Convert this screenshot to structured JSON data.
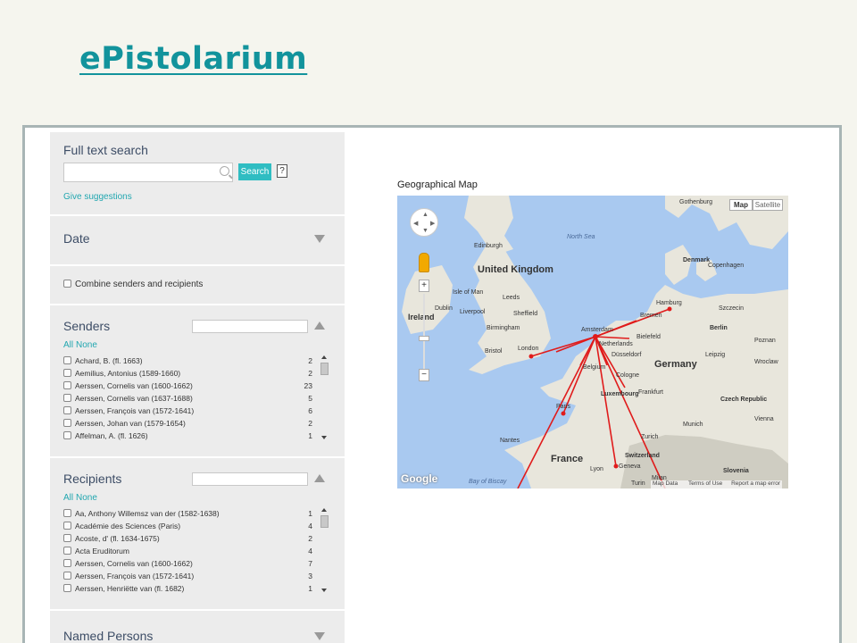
{
  "app_title": "ePistolarium",
  "full_text_search": {
    "heading": "Full text search",
    "search_label": "Search",
    "help_label": "?",
    "suggestions_link": "Give suggestions"
  },
  "date": {
    "heading": "Date"
  },
  "combine": {
    "label": "Combine senders and recipients"
  },
  "senders": {
    "heading": "Senders",
    "all_label": "All",
    "none_label": "None",
    "items": [
      {
        "name": "Achard, B. (fl. 1663)",
        "count": "2"
      },
      {
        "name": "Aemilius, Antonius (1589-1660)",
        "count": "2"
      },
      {
        "name": "Aerssen, Cornelis van (1600-1662)",
        "count": "23"
      },
      {
        "name": "Aerssen, Cornelis van (1637-1688)",
        "count": "5"
      },
      {
        "name": "Aerssen, François van (1572-1641)",
        "count": "6"
      },
      {
        "name": "Aerssen, Johan van (1579-1654)",
        "count": "2"
      },
      {
        "name": "Affelman, A. (fl. 1626)",
        "count": "1"
      }
    ]
  },
  "recipients": {
    "heading": "Recipients",
    "all_label": "All",
    "none_label": "None",
    "items": [
      {
        "name": "Aa, Anthony Willemsz van der (1582-1638)",
        "count": "1"
      },
      {
        "name": "Académie des Sciences (Paris)",
        "count": "4"
      },
      {
        "name": "Acoste, d' (fl. 1634-1675)",
        "count": "2"
      },
      {
        "name": "Acta Eruditorum",
        "count": "4"
      },
      {
        "name": "Aerssen, Cornelis van (1600-1662)",
        "count": "7"
      },
      {
        "name": "Aerssen, François van (1572-1641)",
        "count": "3"
      },
      {
        "name": "Aerssen, Henriëtte van (fl. 1682)",
        "count": "1"
      }
    ]
  },
  "named_persons": {
    "heading": "Named Persons"
  },
  "map": {
    "title": "Geographical Map",
    "type_map": "Map",
    "type_satellite": "Satellite",
    "footer_data": "Map Data",
    "footer_terms": "Terms of Use",
    "footer_report": "Report a map error",
    "google": "Google",
    "labels": {
      "gothenburg": "Gothenburg",
      "north_sea": "North Sea",
      "edinburgh": "Edinburgh",
      "denmark": "Denmark",
      "copenhagen": "Copenhagen",
      "uk": "United Kingdom",
      "isle_of_man": "Isle of Man",
      "leeds": "Leeds",
      "dublin": "Dublin",
      "liverpool": "Liverpool",
      "sheffield": "Sheffield",
      "ireland": "Ireland",
      "hamburg": "Hamburg",
      "bremen": "Bremen",
      "szczecin": "Szczecin",
      "birmingham": "Birmingham",
      "amsterdam": "Amsterdam",
      "netherlands": "Netherlands",
      "bielefeld": "Bielefeld",
      "berlin": "Berlin",
      "poznan": "Poznan",
      "bristol": "Bristol",
      "london": "London",
      "dusseldorf": "Düsseldorf",
      "germany": "Germany",
      "leipzig": "Leipzig",
      "wroclaw": "Wroclaw",
      "belgium": "Belgium",
      "cologne": "Cologne",
      "frankfurt": "Frankfurt",
      "luxembourg": "Luxembourg",
      "czech": "Czech Republic",
      "paris": "Paris",
      "nantes": "Nantes",
      "zurich": "Zurich",
      "munich": "Munich",
      "vienna": "Vienna",
      "france": "France",
      "switzerland": "Switzerland",
      "lyon": "Lyon",
      "geneva": "Geneva",
      "turin": "Turin",
      "milan": "Milan",
      "slovenia": "Slovenia",
      "bay_of_biscay": "Bay of Biscay"
    }
  }
}
